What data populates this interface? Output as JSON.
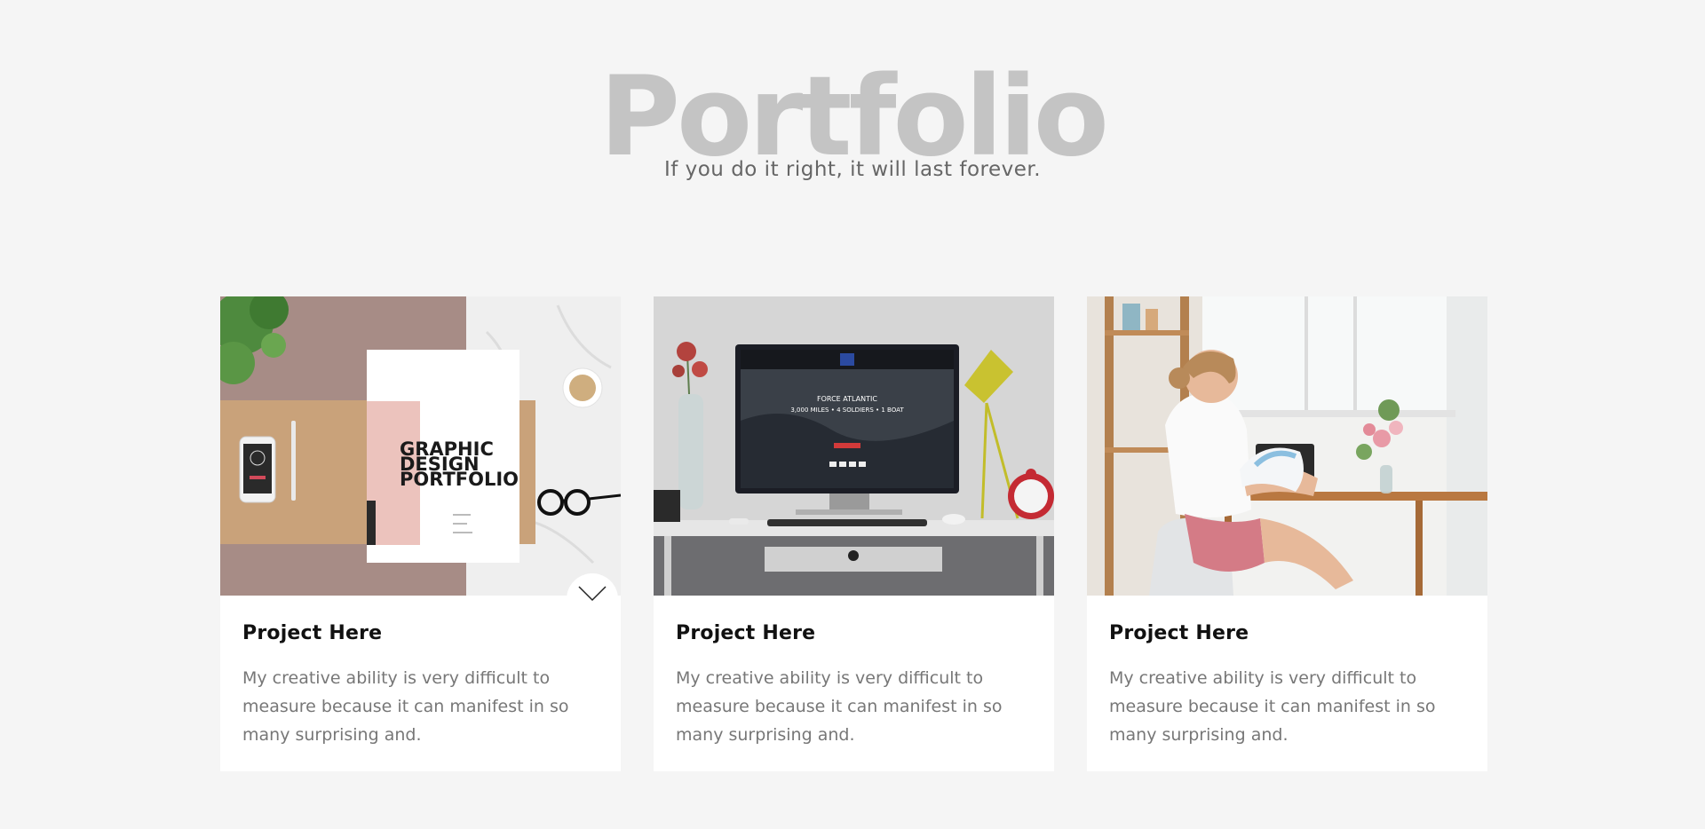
{
  "header": {
    "title": "Portfolio",
    "subtitle": "If you do it right, it will last forever."
  },
  "cards": [
    {
      "title": "Project Here",
      "description": "My creative ability is very difficult to measure because it can manifest in so many surprising and.",
      "image": {
        "mockup_title_line1": "GRAPHIC",
        "mockup_title_line2": "DESIGN",
        "mockup_title_line3": "PORTFOLIO"
      },
      "toggle_icon": "chevron-down-icon"
    },
    {
      "title": "Project Here",
      "description": "My creative ability is very difficult to measure because it can manifest in so many surprising and.",
      "image": {
        "screen_headline": "FORCE ATLANTIC",
        "screen_subline": "3,000 MILES • 4 SOLDIERS • 1 BOAT"
      }
    },
    {
      "title": "Project Here",
      "description": "My creative ability is very difficult to measure because it can manifest in so many surprising and."
    }
  ],
  "colors": {
    "page_background": "#f5f5f5",
    "title_color": "#c4c4c4",
    "subtitle_color": "#666666",
    "card_background": "#ffffff",
    "card_title_color": "#111111",
    "card_text_color": "#777777"
  }
}
